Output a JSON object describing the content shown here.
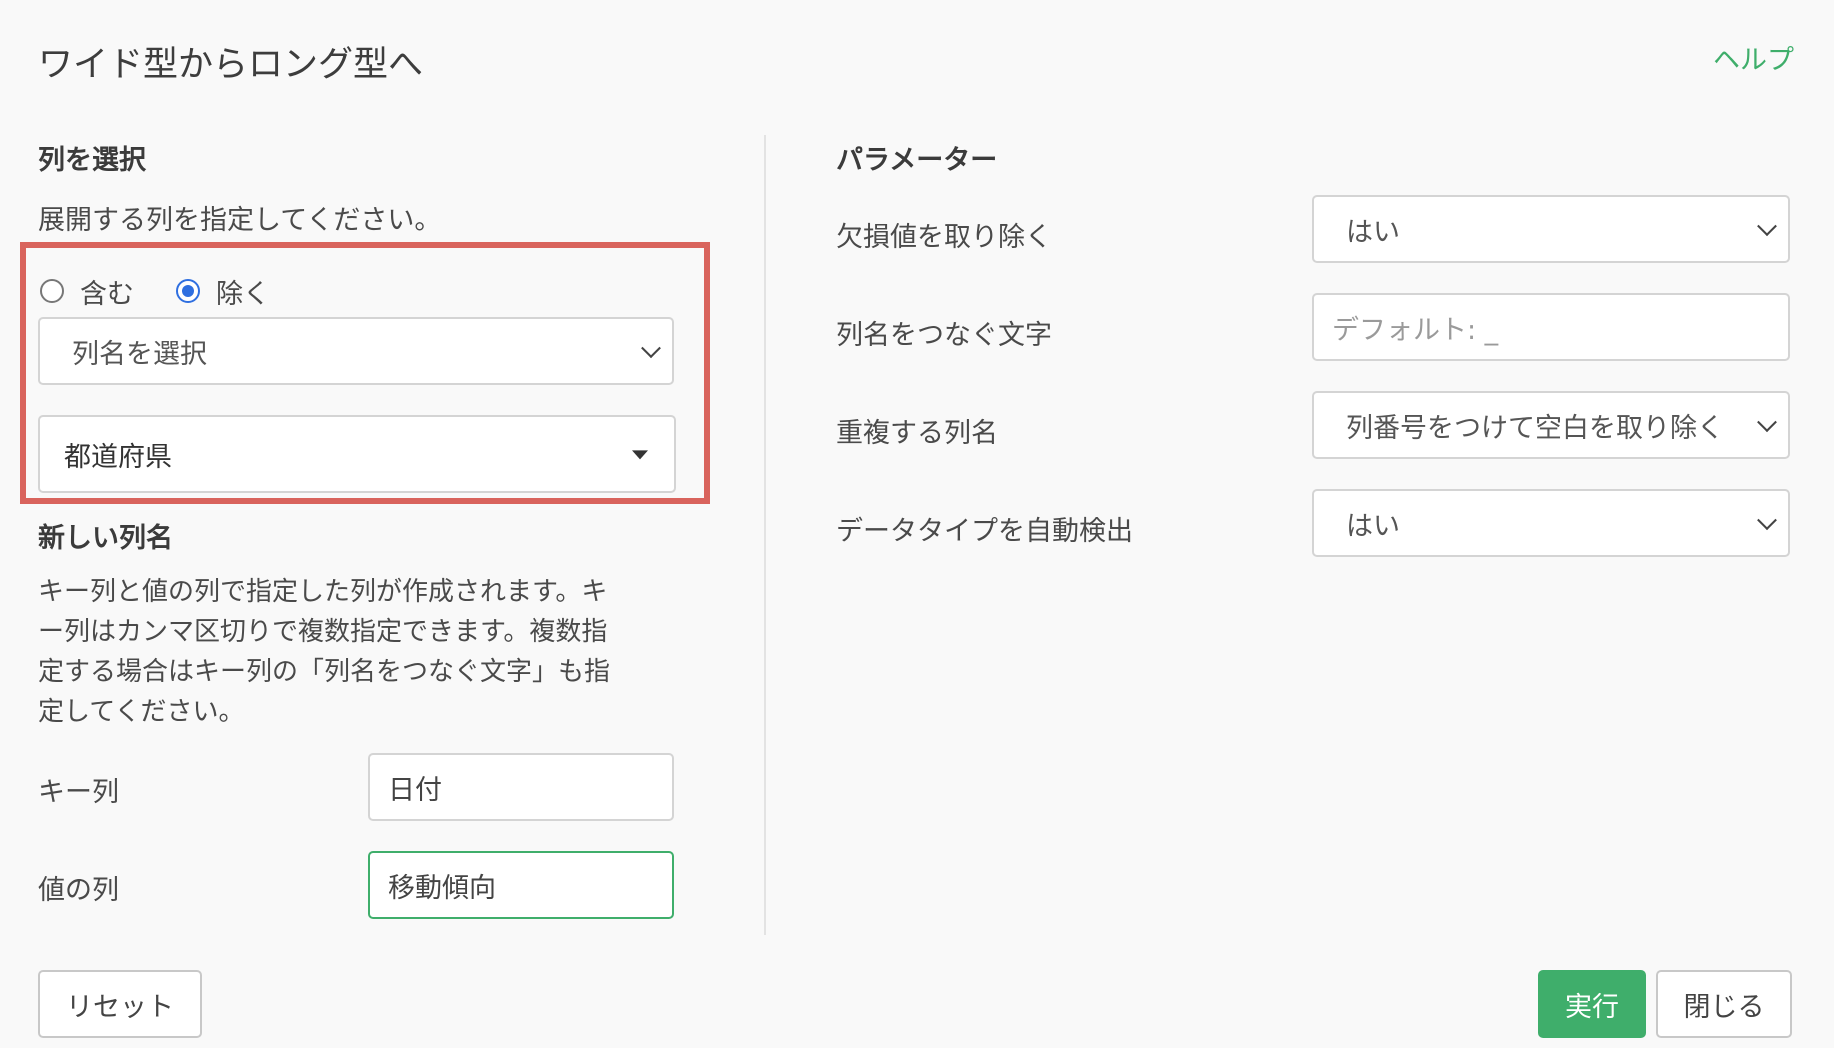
{
  "header": {
    "title": "ワイド型からロング型へ",
    "help_label": "ヘルプ"
  },
  "column_select": {
    "heading": "列を選択",
    "description": "展開する列を指定してください。",
    "radio_include_label": "含む",
    "radio_exclude_label": "除く",
    "selected_mode": "除く",
    "column_picker_placeholder": "列名を選択",
    "selected_column": "都道府県"
  },
  "new_columns": {
    "heading": "新しい列名",
    "description_lines": [
      "キー列と値の列で指定した列が作成されます。キ",
      "ー列はカンマ区切りで複数指定できます。複数指",
      "定する場合はキー列の「列名をつなぐ文字」も指",
      "定してください。"
    ],
    "key_label": "キー列",
    "key_value": "日付",
    "value_label": "値の列",
    "value_value": "移動傾向"
  },
  "parameters": {
    "heading": "パラメーター",
    "remove_na_label": "欠損値を取り除く",
    "remove_na_value": "はい",
    "sep_label": "列名をつなぐ文字",
    "sep_placeholder": "デフォルト: _",
    "dup_label": "重複する列名",
    "dup_value": "列番号をつけて空白を取り除く",
    "auto_type_label": "データタイプを自動検出",
    "auto_type_value": "はい"
  },
  "footer": {
    "reset_label": "リセット",
    "run_label": "実行",
    "close_label": "閉じる"
  },
  "colors": {
    "accent": "#3fae6b",
    "highlight": "#d9645d",
    "radio_selected": "#2f6fe0"
  }
}
